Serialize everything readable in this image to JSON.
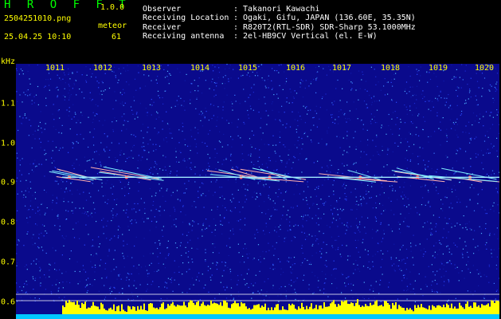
{
  "app": {
    "logo": "H R O F F T",
    "version": "1.0.0"
  },
  "file": {
    "name": "2504251010.png",
    "datetime": "25.04.25 10:10"
  },
  "meteor": {
    "label": "meteor",
    "count": "61"
  },
  "info": [
    {
      "label": "Observer",
      "value": ": Takanori Kawachi"
    },
    {
      "label": "Receiving Location",
      "value": ": Ogaki, Gifu, JAPAN (136.60E, 35.35N)"
    },
    {
      "label": "Receiver",
      "value": ": R820T2(RTL-SDR) SDR-Sharp 53.1000MHz"
    },
    {
      "label": "Receiving antenna",
      "value": ": 2el-HB9CV Vertical (el. E-W)"
    }
  ],
  "colors": {
    "background": "#000000",
    "plot_bg": "#0a0a8c",
    "label": "#ffff00",
    "text": "#ffffff",
    "logo": "#00ff00",
    "carrier": "#9fe8ff",
    "activity": "#ffff00",
    "baseline": "#00c8ff"
  },
  "chart_data": {
    "type": "heatmap",
    "title": "",
    "ylabel": "kHz",
    "x_ticks": [
      "1011",
      "1012",
      "1013",
      "1014",
      "1015",
      "1016",
      "1017",
      "1018",
      "1019",
      "1020"
    ],
    "y_ticks": [
      "1.1",
      "1.0",
      "0.9",
      "0.8",
      "0.7",
      "0.6"
    ],
    "ylim": [
      0.58,
      1.18
    ],
    "carrier_khz": 0.915,
    "meteor_echo_clusters_minute": [
      1011.3,
      1012.5,
      1014.9,
      1015.5,
      1017.4,
      1018.6,
      1019.7
    ]
  }
}
